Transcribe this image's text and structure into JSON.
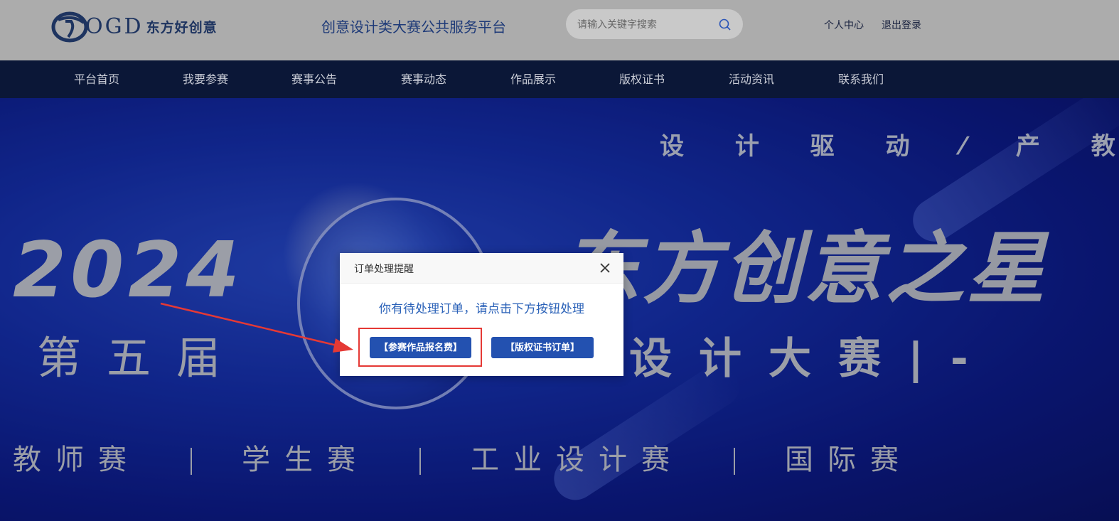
{
  "header": {
    "logo_letters": "OGD",
    "logo_cn": "东方好创意",
    "platform_title": "创意设计类大赛公共服务平台",
    "search_placeholder": "请输入关键字搜索",
    "personal_center": "个人中心",
    "logout": "退出登录"
  },
  "nav": {
    "items": [
      "平台首页",
      "我要参赛",
      "赛事公告",
      "赛事动态",
      "作品展示",
      "版权证书",
      "活动资讯",
      "联系我们"
    ]
  },
  "banner": {
    "slogan": "设 计 驱 动 ⁄ 产 教 融 合",
    "year": "2024",
    "edition": "第五届",
    "title": "东方创意之星",
    "subtitle": "设计大赛",
    "subtitle_suffix": "|-",
    "categories": [
      "教师赛",
      "学生赛",
      "工业设计赛",
      "国际赛"
    ]
  },
  "modal": {
    "title": "订单处理提醒",
    "message": "你有待处理订单，请点击下方按钮处理",
    "btn_entry_fee": "【参赛作品报名费】",
    "btn_certificate": "【版权证书订单】"
  },
  "colors": {
    "accent": "#2351b0",
    "highlight": "#e53935",
    "nav_bg": "#0b1737"
  }
}
